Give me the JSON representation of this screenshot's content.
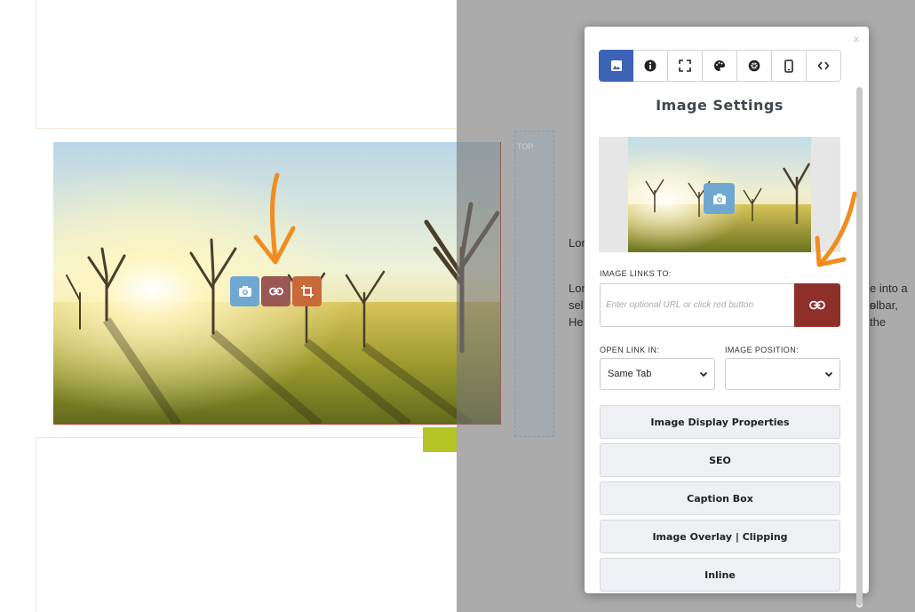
{
  "modal": {
    "close_icon": "×",
    "title": "Image Settings",
    "tabs": [
      {
        "icon": "image-icon",
        "active": true
      },
      {
        "icon": "info-icon",
        "active": false
      },
      {
        "icon": "fullscreen-icon",
        "active": false
      },
      {
        "icon": "palette-icon",
        "active": false
      },
      {
        "icon": "aperture-icon",
        "active": false
      },
      {
        "icon": "mobile-icon",
        "active": false
      },
      {
        "icon": "code-icon",
        "active": false
      }
    ],
    "image_links_label": "IMAGE LINKS TO:",
    "url_placeholder": "Enter optional URL or click red button",
    "url_value": "",
    "open_link_label": "OPEN LINK IN:",
    "open_link_value": "Same Tab",
    "image_position_label": "IMAGE POSITION:",
    "image_position_value": "",
    "sections": [
      "Image Display Properties",
      "SEO",
      "Caption Box",
      "Image Overlay | Clipping",
      "Inline"
    ]
  },
  "background": {
    "top_label": "TOP",
    "text_lines": [
      "Lor",
      "Lor",
      "sel",
      "He"
    ],
    "right_text_1": "e into a s",
    "right_text_2": "olbar, the"
  },
  "image_toolbar": [
    "camera-icon",
    "link-icon",
    "crop-icon"
  ],
  "colors": {
    "active_tab": "#3c63b6",
    "link_button": "#8f2f2a",
    "arrow": "#f08c1e",
    "camera_button": "#6fa7d1",
    "green_handle": "#b4c424"
  }
}
